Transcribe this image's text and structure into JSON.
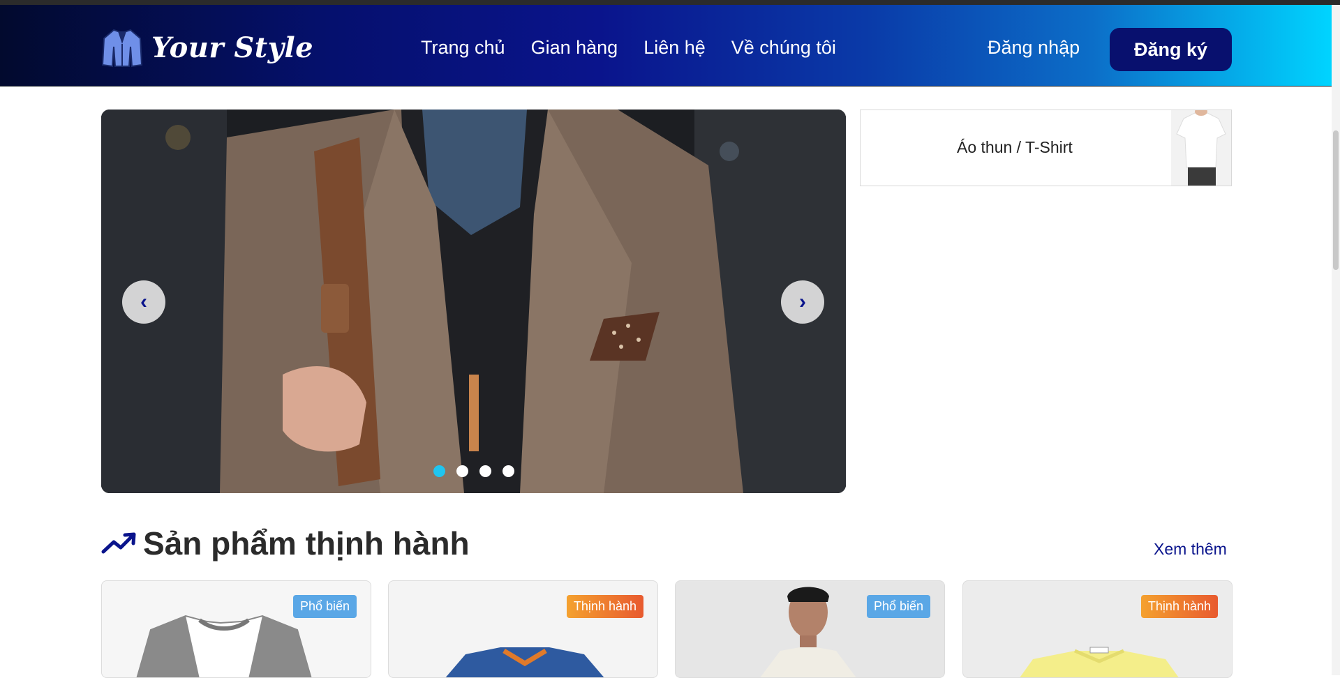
{
  "header": {
    "brand": "Your Style",
    "nav": [
      "Trang chủ",
      "Gian hàng",
      "Liên hệ",
      "Về chúng tôi"
    ],
    "login": "Đăng nhập",
    "signup": "Đăng ký"
  },
  "carousel": {
    "slide_count": 4,
    "active_index": 0
  },
  "category": {
    "label": "Áo thun / T-Shirt"
  },
  "trending": {
    "title": "Sản phẩm thịnh hành",
    "more": "Xem thêm",
    "products": [
      {
        "badge": "Phổ biến"
      },
      {
        "badge": "Thịnh hành"
      },
      {
        "badge": "Phổ biến"
      },
      {
        "badge": "Thịnh hành"
      }
    ]
  },
  "colors": {
    "brand_dark": "#0a148c",
    "accent_cyan": "#00d4ff",
    "dot_active": "#1fc5f0"
  }
}
